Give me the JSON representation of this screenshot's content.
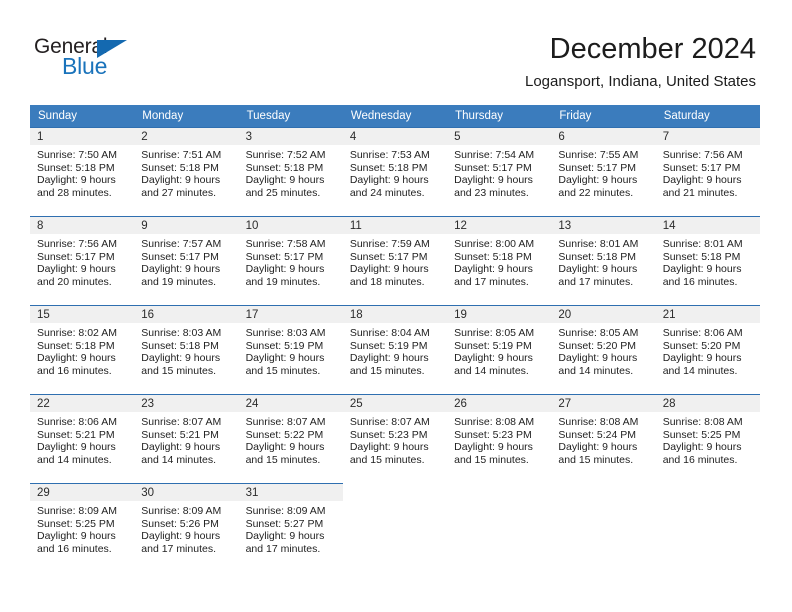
{
  "brand": {
    "name_part1": "General",
    "name_part2": "Blue",
    "accent_color": "#1a73bb",
    "triangle_color": "#1469b0"
  },
  "header": {
    "title": "December 2024",
    "subtitle": "Logansport, Indiana, United States"
  },
  "theme": {
    "header_bg": "#3b7cbd",
    "day_band_bg": "#f0f0f0",
    "cell_border": "#2f6fb0"
  },
  "weekday_headers": [
    "Sunday",
    "Monday",
    "Tuesday",
    "Wednesday",
    "Thursday",
    "Friday",
    "Saturday"
  ],
  "weeks": [
    [
      {
        "day": "1",
        "sunrise": "Sunrise: 7:50 AM",
        "sunset": "Sunset: 5:18 PM",
        "daylight1": "Daylight: 9 hours",
        "daylight2": "and 28 minutes."
      },
      {
        "day": "2",
        "sunrise": "Sunrise: 7:51 AM",
        "sunset": "Sunset: 5:18 PM",
        "daylight1": "Daylight: 9 hours",
        "daylight2": "and 27 minutes."
      },
      {
        "day": "3",
        "sunrise": "Sunrise: 7:52 AM",
        "sunset": "Sunset: 5:18 PM",
        "daylight1": "Daylight: 9 hours",
        "daylight2": "and 25 minutes."
      },
      {
        "day": "4",
        "sunrise": "Sunrise: 7:53 AM",
        "sunset": "Sunset: 5:18 PM",
        "daylight1": "Daylight: 9 hours",
        "daylight2": "and 24 minutes."
      },
      {
        "day": "5",
        "sunrise": "Sunrise: 7:54 AM",
        "sunset": "Sunset: 5:17 PM",
        "daylight1": "Daylight: 9 hours",
        "daylight2": "and 23 minutes."
      },
      {
        "day": "6",
        "sunrise": "Sunrise: 7:55 AM",
        "sunset": "Sunset: 5:17 PM",
        "daylight1": "Daylight: 9 hours",
        "daylight2": "and 22 minutes."
      },
      {
        "day": "7",
        "sunrise": "Sunrise: 7:56 AM",
        "sunset": "Sunset: 5:17 PM",
        "daylight1": "Daylight: 9 hours",
        "daylight2": "and 21 minutes."
      }
    ],
    [
      {
        "day": "8",
        "sunrise": "Sunrise: 7:56 AM",
        "sunset": "Sunset: 5:17 PM",
        "daylight1": "Daylight: 9 hours",
        "daylight2": "and 20 minutes."
      },
      {
        "day": "9",
        "sunrise": "Sunrise: 7:57 AM",
        "sunset": "Sunset: 5:17 PM",
        "daylight1": "Daylight: 9 hours",
        "daylight2": "and 19 minutes."
      },
      {
        "day": "10",
        "sunrise": "Sunrise: 7:58 AM",
        "sunset": "Sunset: 5:17 PM",
        "daylight1": "Daylight: 9 hours",
        "daylight2": "and 19 minutes."
      },
      {
        "day": "11",
        "sunrise": "Sunrise: 7:59 AM",
        "sunset": "Sunset: 5:17 PM",
        "daylight1": "Daylight: 9 hours",
        "daylight2": "and 18 minutes."
      },
      {
        "day": "12",
        "sunrise": "Sunrise: 8:00 AM",
        "sunset": "Sunset: 5:18 PM",
        "daylight1": "Daylight: 9 hours",
        "daylight2": "and 17 minutes."
      },
      {
        "day": "13",
        "sunrise": "Sunrise: 8:01 AM",
        "sunset": "Sunset: 5:18 PM",
        "daylight1": "Daylight: 9 hours",
        "daylight2": "and 17 minutes."
      },
      {
        "day": "14",
        "sunrise": "Sunrise: 8:01 AM",
        "sunset": "Sunset: 5:18 PM",
        "daylight1": "Daylight: 9 hours",
        "daylight2": "and 16 minutes."
      }
    ],
    [
      {
        "day": "15",
        "sunrise": "Sunrise: 8:02 AM",
        "sunset": "Sunset: 5:18 PM",
        "daylight1": "Daylight: 9 hours",
        "daylight2": "and 16 minutes."
      },
      {
        "day": "16",
        "sunrise": "Sunrise: 8:03 AM",
        "sunset": "Sunset: 5:18 PM",
        "daylight1": "Daylight: 9 hours",
        "daylight2": "and 15 minutes."
      },
      {
        "day": "17",
        "sunrise": "Sunrise: 8:03 AM",
        "sunset": "Sunset: 5:19 PM",
        "daylight1": "Daylight: 9 hours",
        "daylight2": "and 15 minutes."
      },
      {
        "day": "18",
        "sunrise": "Sunrise: 8:04 AM",
        "sunset": "Sunset: 5:19 PM",
        "daylight1": "Daylight: 9 hours",
        "daylight2": "and 15 minutes."
      },
      {
        "day": "19",
        "sunrise": "Sunrise: 8:05 AM",
        "sunset": "Sunset: 5:19 PM",
        "daylight1": "Daylight: 9 hours",
        "daylight2": "and 14 minutes."
      },
      {
        "day": "20",
        "sunrise": "Sunrise: 8:05 AM",
        "sunset": "Sunset: 5:20 PM",
        "daylight1": "Daylight: 9 hours",
        "daylight2": "and 14 minutes."
      },
      {
        "day": "21",
        "sunrise": "Sunrise: 8:06 AM",
        "sunset": "Sunset: 5:20 PM",
        "daylight1": "Daylight: 9 hours",
        "daylight2": "and 14 minutes."
      }
    ],
    [
      {
        "day": "22",
        "sunrise": "Sunrise: 8:06 AM",
        "sunset": "Sunset: 5:21 PM",
        "daylight1": "Daylight: 9 hours",
        "daylight2": "and 14 minutes."
      },
      {
        "day": "23",
        "sunrise": "Sunrise: 8:07 AM",
        "sunset": "Sunset: 5:21 PM",
        "daylight1": "Daylight: 9 hours",
        "daylight2": "and 14 minutes."
      },
      {
        "day": "24",
        "sunrise": "Sunrise: 8:07 AM",
        "sunset": "Sunset: 5:22 PM",
        "daylight1": "Daylight: 9 hours",
        "daylight2": "and 15 minutes."
      },
      {
        "day": "25",
        "sunrise": "Sunrise: 8:07 AM",
        "sunset": "Sunset: 5:23 PM",
        "daylight1": "Daylight: 9 hours",
        "daylight2": "and 15 minutes."
      },
      {
        "day": "26",
        "sunrise": "Sunrise: 8:08 AM",
        "sunset": "Sunset: 5:23 PM",
        "daylight1": "Daylight: 9 hours",
        "daylight2": "and 15 minutes."
      },
      {
        "day": "27",
        "sunrise": "Sunrise: 8:08 AM",
        "sunset": "Sunset: 5:24 PM",
        "daylight1": "Daylight: 9 hours",
        "daylight2": "and 15 minutes."
      },
      {
        "day": "28",
        "sunrise": "Sunrise: 8:08 AM",
        "sunset": "Sunset: 5:25 PM",
        "daylight1": "Daylight: 9 hours",
        "daylight2": "and 16 minutes."
      }
    ],
    [
      {
        "day": "29",
        "sunrise": "Sunrise: 8:09 AM",
        "sunset": "Sunset: 5:25 PM",
        "daylight1": "Daylight: 9 hours",
        "daylight2": "and 16 minutes."
      },
      {
        "day": "30",
        "sunrise": "Sunrise: 8:09 AM",
        "sunset": "Sunset: 5:26 PM",
        "daylight1": "Daylight: 9 hours",
        "daylight2": "and 17 minutes."
      },
      {
        "day": "31",
        "sunrise": "Sunrise: 8:09 AM",
        "sunset": "Sunset: 5:27 PM",
        "daylight1": "Daylight: 9 hours",
        "daylight2": "and 17 minutes."
      },
      {
        "day": "",
        "sunrise": "",
        "sunset": "",
        "daylight1": "",
        "daylight2": ""
      },
      {
        "day": "",
        "sunrise": "",
        "sunset": "",
        "daylight1": "",
        "daylight2": ""
      },
      {
        "day": "",
        "sunrise": "",
        "sunset": "",
        "daylight1": "",
        "daylight2": ""
      },
      {
        "day": "",
        "sunrise": "",
        "sunset": "",
        "daylight1": "",
        "daylight2": ""
      }
    ]
  ]
}
